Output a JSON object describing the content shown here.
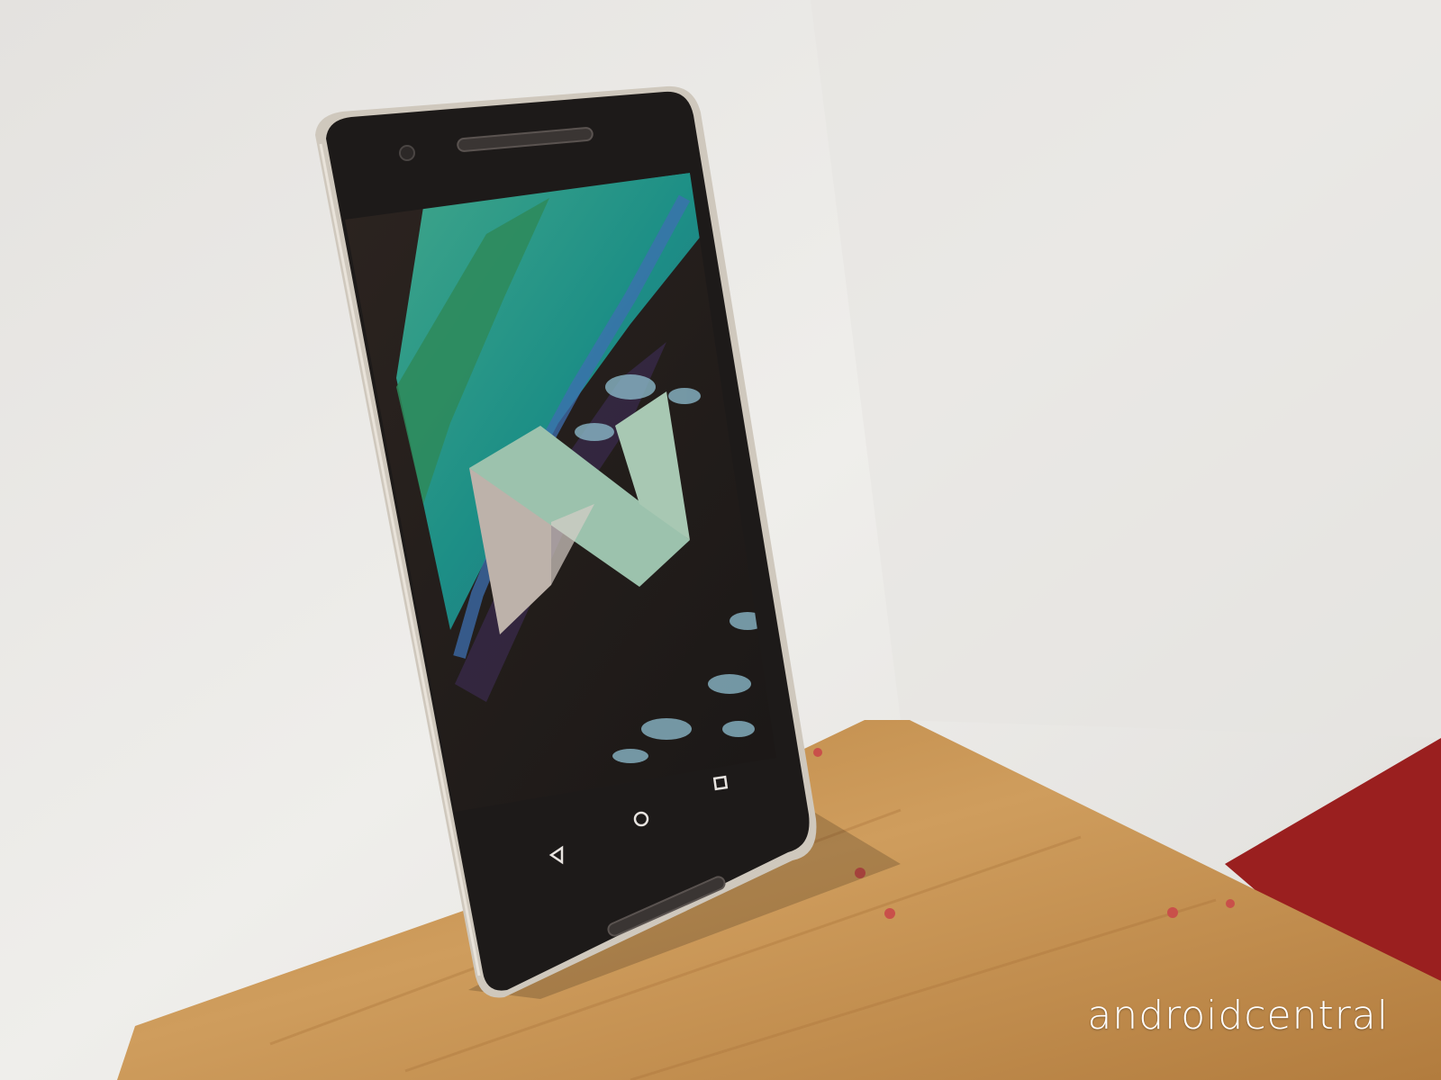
{
  "photo": {
    "subject": "smartphone",
    "screen_content": "android-n-logo-wallpaper",
    "nav_buttons": [
      "back-icon",
      "home-icon",
      "recents-icon"
    ]
  },
  "watermark": {
    "text": "androidcentral"
  },
  "colors": {
    "wall": "#ecebe8",
    "table_wood": "#c18d4d",
    "red_stool": "#9a1f1f",
    "phone_bezel": "#1d1a19",
    "phone_frame": "#cfc8bd",
    "logo_green": "#9cc2ad",
    "logo_beige": "#bdb2aa"
  }
}
